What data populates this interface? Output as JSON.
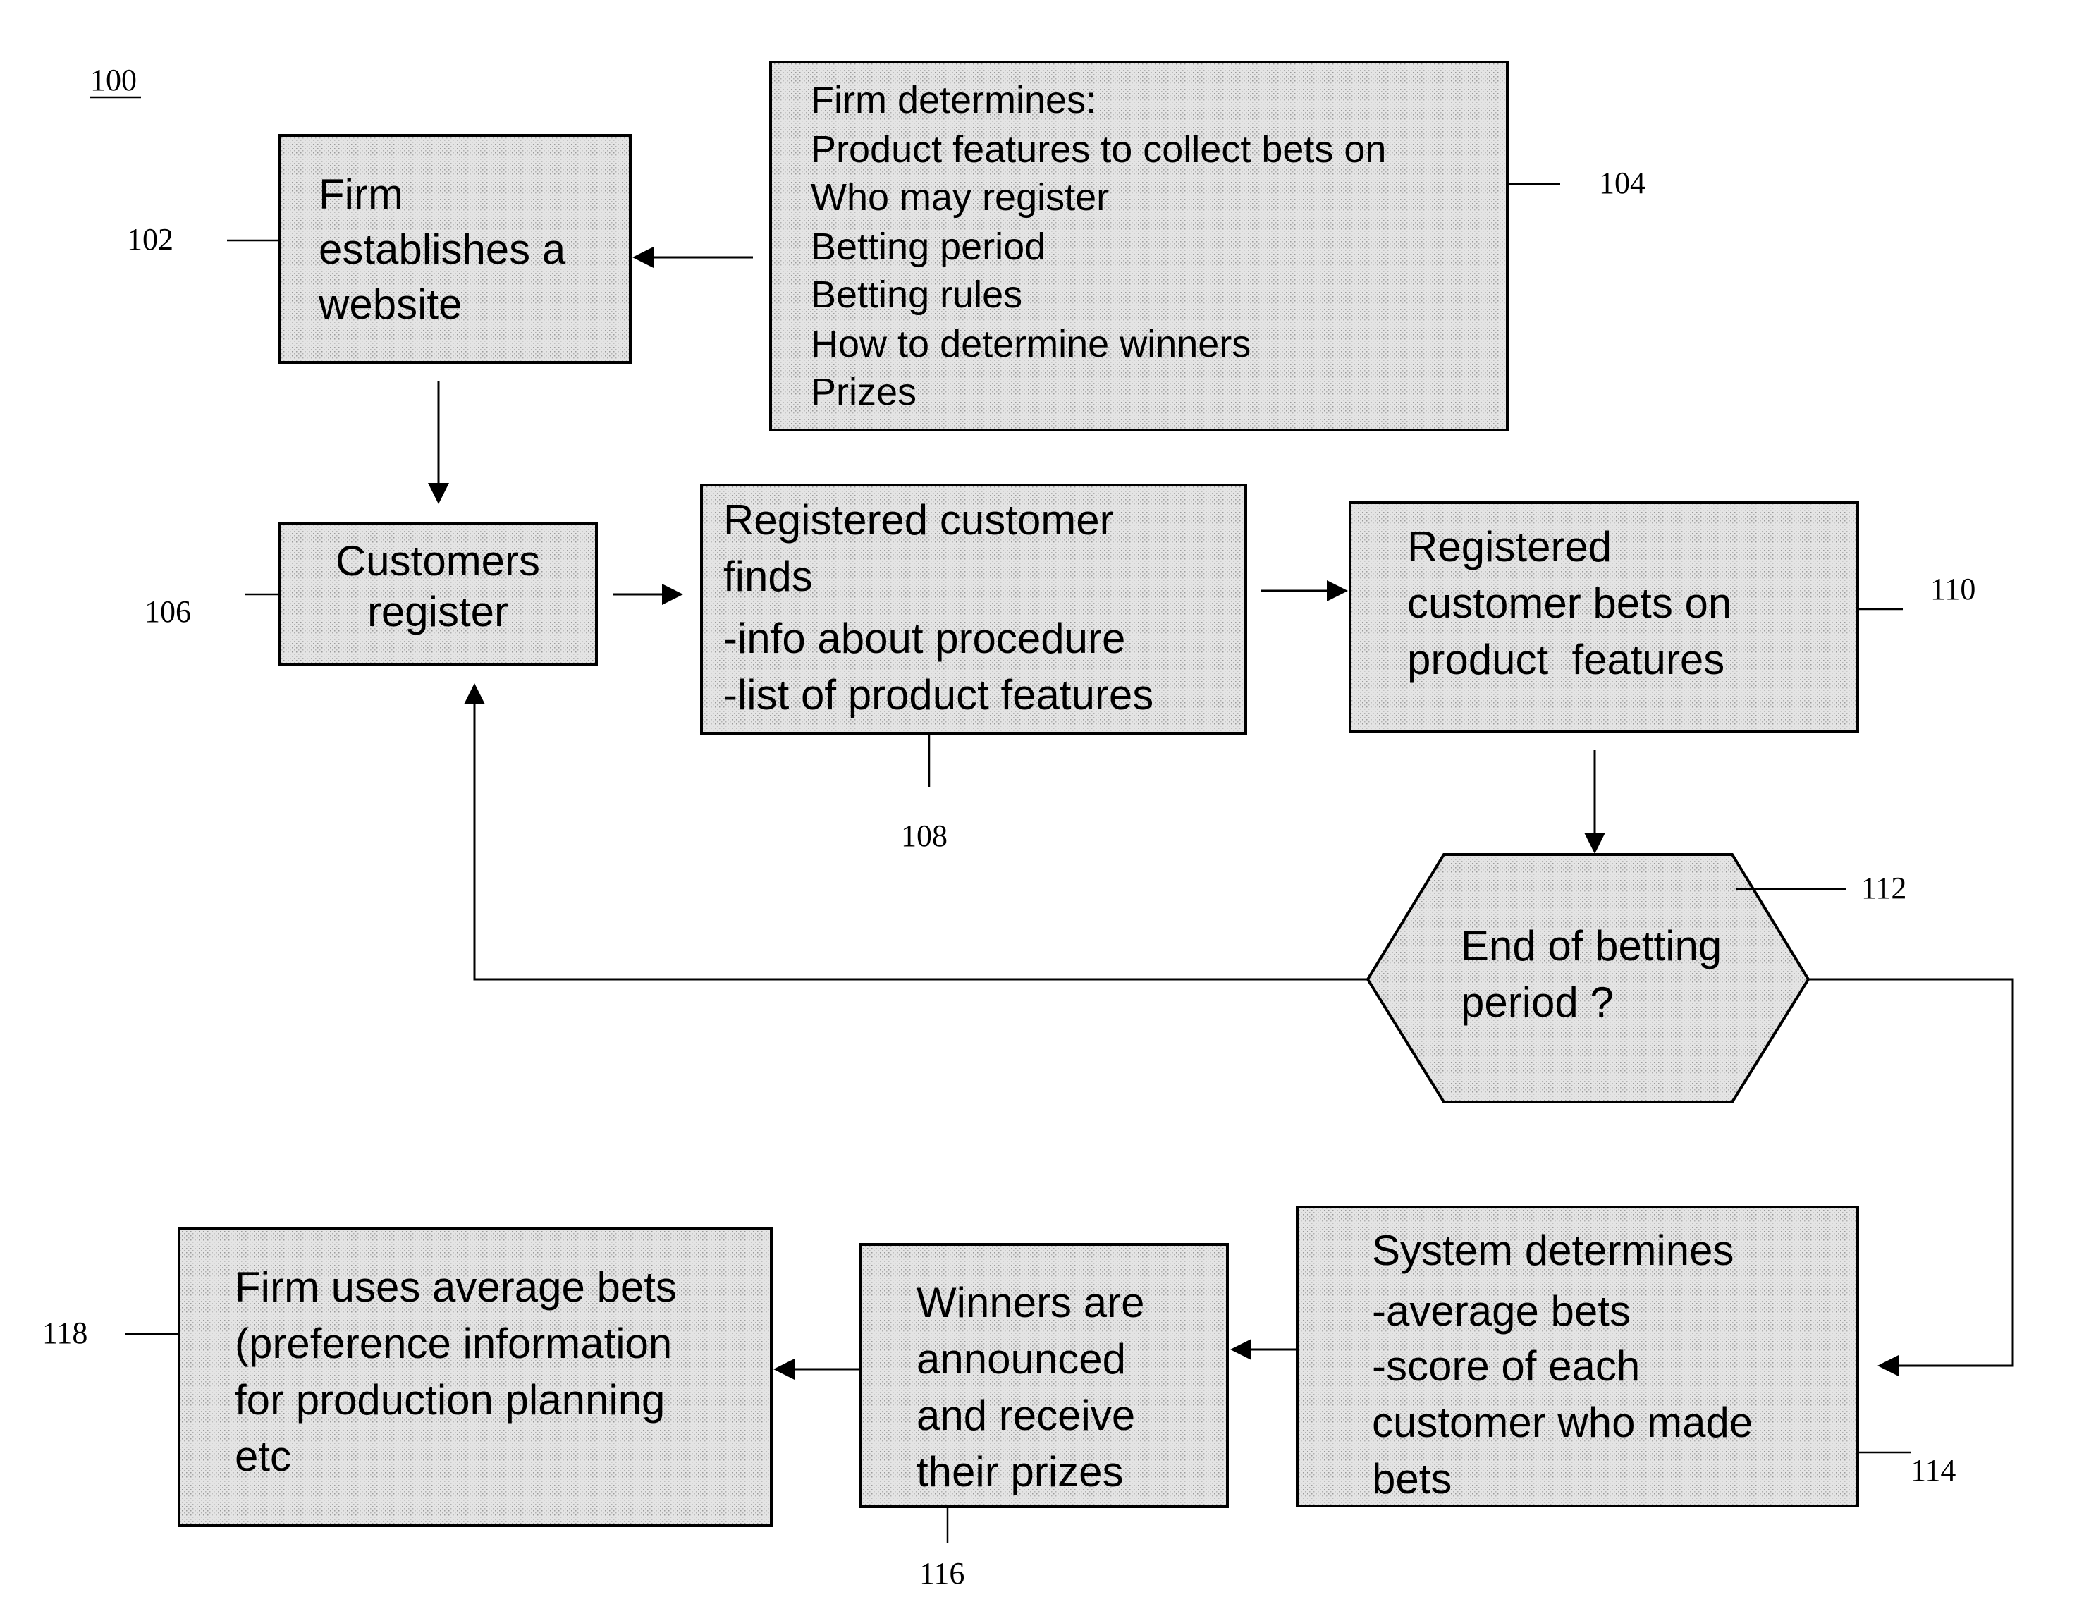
{
  "figure": {
    "number": "100"
  },
  "nodes": {
    "n102": {
      "ref": "102",
      "lines": [
        "Firm",
        "establishes a",
        "website"
      ]
    },
    "n104": {
      "ref": "104",
      "lines": [
        "Firm determines:",
        "Product features to collect bets on",
        "Who may register",
        "Betting period",
        "Betting rules",
        "How to determine winners",
        "Prizes"
      ]
    },
    "n106": {
      "ref": "106",
      "lines": [
        "Customers",
        "register"
      ]
    },
    "n108": {
      "ref": "108",
      "lines": [
        "Registered customer",
        "finds",
        "-info about procedure",
        "-list of product features"
      ]
    },
    "n110": {
      "ref": "110",
      "lines": [
        "Registered",
        "customer bets on",
        "product  features"
      ]
    },
    "n112": {
      "ref": "112",
      "lines": [
        "End of betting",
        "period ?"
      ]
    },
    "n114": {
      "ref": "114",
      "lines": [
        "System determines",
        "-average bets",
        "-score of each",
        "customer who made",
        "bets"
      ]
    },
    "n116": {
      "ref": "116",
      "lines": [
        "Winners are",
        "announced",
        "and receive",
        "their prizes"
      ]
    },
    "n118": {
      "ref": "118",
      "lines": [
        "Firm uses average bets",
        "(preference information",
        "for production planning",
        "etc"
      ]
    }
  },
  "edges": [
    {
      "from": "104",
      "to": "102"
    },
    {
      "from": "102",
      "to": "106"
    },
    {
      "from": "106",
      "to": "108"
    },
    {
      "from": "108",
      "to": "110"
    },
    {
      "from": "110",
      "to": "112"
    },
    {
      "from": "112",
      "to": "106",
      "note": "loop back"
    },
    {
      "from": "112",
      "to": "114"
    },
    {
      "from": "114",
      "to": "116"
    },
    {
      "from": "116",
      "to": "118"
    }
  ]
}
